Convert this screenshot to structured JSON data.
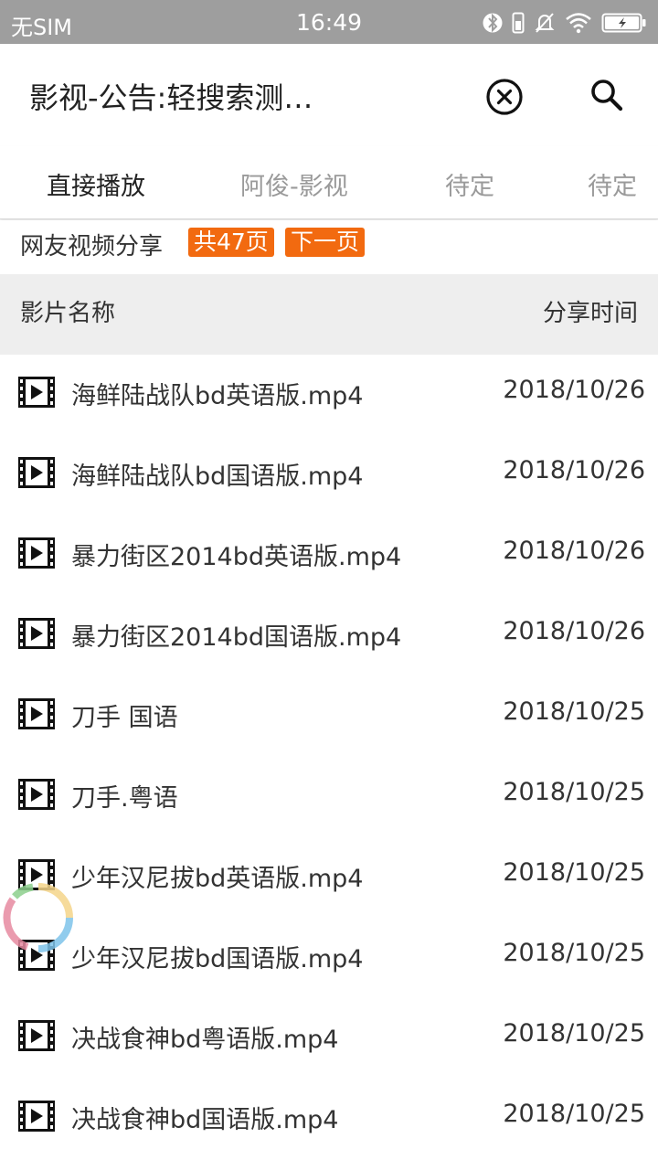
{
  "status_bar": {
    "carrier": "无SIM",
    "time": "16:49",
    "icons": [
      "bluetooth-icon",
      "vibrate-icon",
      "mute-bell-icon",
      "wifi-icon",
      "battery-charging-icon"
    ]
  },
  "header": {
    "title": "影视-公告:轻搜索测…",
    "clear_icon": "clear-circle-icon",
    "search_icon": "search-icon"
  },
  "tabs": [
    {
      "label": "直接播放",
      "active": true
    },
    {
      "label": "阿俊-影视",
      "active": false
    },
    {
      "label": "待定",
      "active": false
    },
    {
      "label": "待定",
      "active": false
    }
  ],
  "share_bar": {
    "label": "网友视频分享",
    "pages_badge": "共47页",
    "next_badge": "下一页",
    "badge_color": "#f26a10"
  },
  "table": {
    "col_name": "影片名称",
    "col_time": "分享时间",
    "rows": [
      {
        "name": "海鲜陆战队bd英语版.mp4",
        "date": "2018/10/26"
      },
      {
        "name": "海鲜陆战队bd国语版.mp4",
        "date": "2018/10/26"
      },
      {
        "name": "暴力街区2014bd英语版.mp4",
        "date": "2018/10/26"
      },
      {
        "name": "暴力街区2014bd国语版.mp4",
        "date": "2018/10/26"
      },
      {
        "name": "刀手 国语",
        "date": "2018/10/25"
      },
      {
        "name": "刀手.粤语",
        "date": "2018/10/25"
      },
      {
        "name": "少年汉尼拔bd英语版.mp4",
        "date": "2018/10/25"
      },
      {
        "name": "少年汉尼拔bd国语版.mp4",
        "date": "2018/10/25"
      },
      {
        "name": "决战食神bd粤语版.mp4",
        "date": "2018/10/25"
      },
      {
        "name": "决战食神bd国语版.mp4",
        "date": "2018/10/25"
      }
    ]
  }
}
